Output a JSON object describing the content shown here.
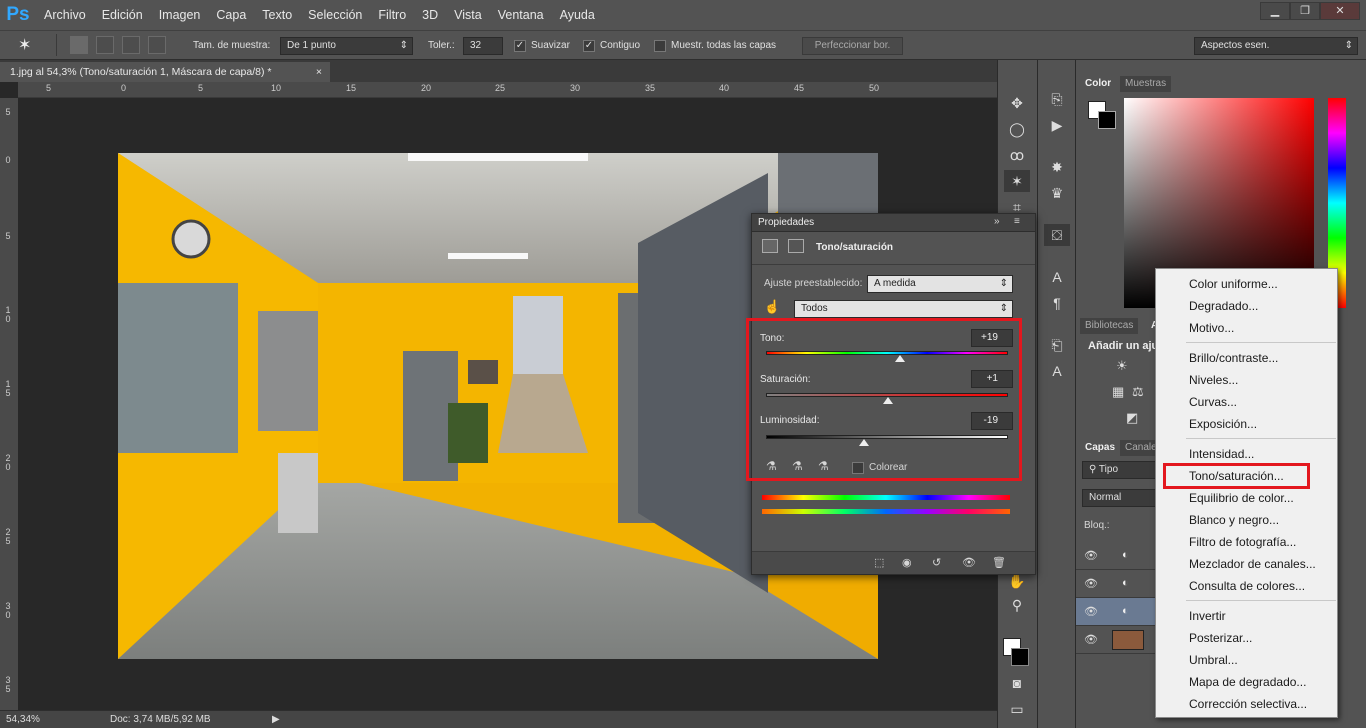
{
  "app": {
    "logo": "Ps"
  },
  "menu": [
    "Archivo",
    "Edición",
    "Imagen",
    "Capa",
    "Texto",
    "Selección",
    "Filtro",
    "3D",
    "Vista",
    "Ventana",
    "Ayuda"
  ],
  "window_controls": {
    "minimize": "▁",
    "restore": "❐",
    "close": "✕"
  },
  "options": {
    "sample_size_label": "Tam. de muestra:",
    "sample_size_value": "De 1 punto",
    "tolerance_label": "Toler.:",
    "tolerance_value": "32",
    "smooth_label": "Suavizar",
    "contiguous_label": "Contiguo",
    "sample_all_label": "Muestr. todas las capas",
    "refine_button": "Perfeccionar bor.",
    "workspace_value": "Aspectos esen."
  },
  "document": {
    "tab_title": "1.jpg al 54,3% (Tono/saturación 1, Máscara de capa/8) *",
    "tab_close": "×",
    "zoom": "54,34%",
    "doc_size": "Doc: 3,74 MB/5,92 MB"
  },
  "ruler": {
    "h_labels": [
      "5",
      "0",
      "5",
      "10",
      "15",
      "20",
      "25",
      "30",
      "35",
      "40",
      "45",
      "50"
    ],
    "v_labels": [
      "5",
      "0",
      "5",
      "1 0",
      "1 5",
      "2 0",
      "2 5",
      "3 0",
      "3 5"
    ]
  },
  "properties": {
    "panel_title": "Propiedades",
    "heading": "Tono/saturación",
    "preset_label": "Ajuste preestablecido:",
    "preset_value": "A medida",
    "channel_value": "Todos",
    "hue_label": "Tono:",
    "hue_value": "+19",
    "saturation_label": "Saturación:",
    "saturation_value": "+1",
    "lightness_label": "Luminosidad:",
    "lightness_value": "-19",
    "colorize_label": "Colorear",
    "hue_fraction": 0.553,
    "saturation_fraction": 0.505,
    "lightness_fraction": 0.405
  },
  "panels": {
    "color_tab": "Color",
    "swatches_tab": "Muestras",
    "libraries_tab": "Bibliotecas",
    "adjust_tab": "A",
    "add_adjustment": "Añadir un aju",
    "layers_tab": "Capas",
    "channels_tab": "Canale",
    "filter_kind": "Tipo",
    "blend_mode": "Normal",
    "lock_label": "Bloq.:"
  },
  "context_menu": {
    "group1": [
      "Color uniforme...",
      "Degradado...",
      "Motivo..."
    ],
    "group2": [
      "Brillo/contraste...",
      "Niveles...",
      "Curvas...",
      "Exposición..."
    ],
    "group3": [
      "Intensidad...",
      "Tono/saturación...",
      "Equilibrio de color...",
      "Blanco y negro...",
      "Filtro de fotografía...",
      "Mezclador de canales...",
      "Consulta de colores..."
    ],
    "group4": [
      "Invertir",
      "Posterizar...",
      "Umbral...",
      "Mapa de degradado...",
      "Corrección selectiva..."
    ]
  },
  "colors": {
    "highlight": "#e3171e",
    "ps_blue": "#31a8ff",
    "wall_yellow": "#f5b400"
  }
}
